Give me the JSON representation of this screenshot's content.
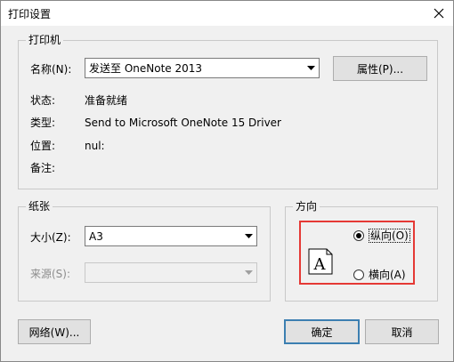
{
  "window": {
    "title": "打印设置",
    "close_glyph": "✕"
  },
  "printer": {
    "group_title": "打印机",
    "name_label": "名称(N):",
    "name_value": "发送至 OneNote 2013",
    "properties_button": "属性(P)...",
    "status_label": "状态:",
    "status_value": "准备就绪",
    "type_label": "类型:",
    "type_value": "Send to Microsoft OneNote 15 Driver",
    "where_label": "位置:",
    "where_value": "nul:",
    "comment_label": "备注:",
    "comment_value": ""
  },
  "paper": {
    "group_title": "纸张",
    "size_label": "大小(Z):",
    "size_value": "A3",
    "source_label": "来源(S):",
    "source_value": ""
  },
  "orientation": {
    "group_title": "方向",
    "icon_letter": "A",
    "portrait_label": "纵向(O)",
    "landscape_label": "横向(A)",
    "selected": "portrait",
    "highlight_color": "#e53935"
  },
  "buttons": {
    "network": "网络(W)...",
    "ok": "确定",
    "cancel": "取消"
  }
}
